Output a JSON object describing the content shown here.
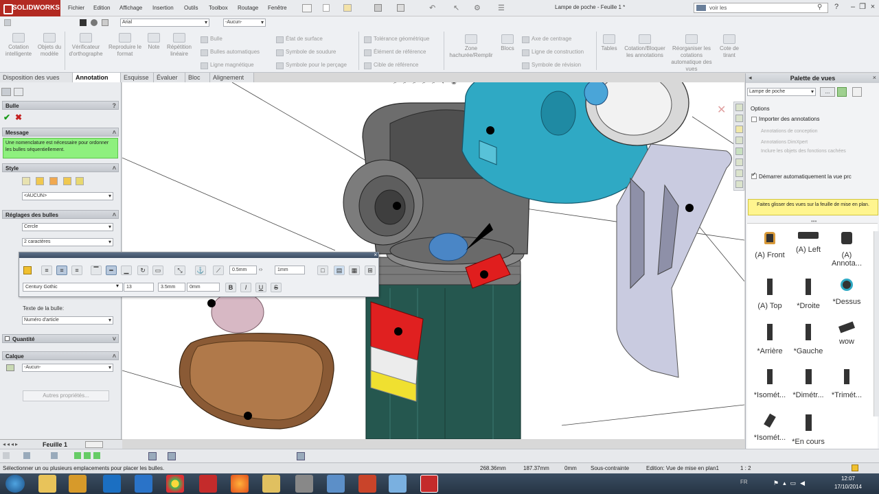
{
  "app": {
    "logo": "SOLIDWORKS",
    "document_title": "Lampe de poche - Feuille 1 *",
    "search_placeholder": "voir les"
  },
  "menu": [
    "Fichier",
    "Edition",
    "Affichage",
    "Insertion",
    "Outils",
    "Toolbox",
    "Routage",
    "Fenêtre"
  ],
  "ribbon": {
    "font_combo": "Arial",
    "font_size_combo": "-Aucun-",
    "big_buttons": [
      "Cotation intelligente",
      "Objets du modèle",
      "Vérificateur d'orthographe",
      "Reproduire le format",
      "Note",
      "Répétition linéaire"
    ],
    "col1": [
      "Bulle",
      "Bulles automatiques",
      "Ligne magnétique"
    ],
    "col2": [
      "État de surface",
      "Symbole de soudure",
      "Symbole pour le perçage"
    ],
    "col3": [
      "Tolérance géométrique",
      "Élément de référence",
      "Cible de référence"
    ],
    "big2": [
      "Zone hachurée/Remplir",
      "Blocs"
    ],
    "col4": [
      "Axe de centrage",
      "Ligne de construction",
      "Symbole de révision"
    ],
    "big3": [
      "Tables",
      "Cotation/Bloquer les annotations",
      "Réorganiser les cotations automatique des vues",
      "Cote de tirant"
    ]
  },
  "tabs": [
    "Disposition des vues",
    "Annotation",
    "Esquisse",
    "Évaluer",
    "Bloc",
    "Alignement"
  ],
  "left_panel": {
    "title": "Bulle",
    "message_header": "Message",
    "message_text": "Une nomenclature est nécessaire pour ordonner les bulles séquentiellement.",
    "style_header": "Style",
    "style_combo": "<AUCUN>",
    "settings_header": "Réglages des bulles",
    "shape_combo": "Cercle",
    "size_combo": "2 caractères",
    "text_label": "Texte de la bulle:",
    "text_combo": "Numéro d'article",
    "quantity_header": "Quantité",
    "layer_header": "Calque",
    "layer_combo": "-Aucun-",
    "more_button": "Autres propriétés..."
  },
  "format_toolbar": {
    "font": "Century Gothic",
    "size": "13",
    "spacing1": "3.5mm",
    "spacing2": "0mm",
    "thickness": "0.5mm",
    "gap": "1mm",
    "bold": "B",
    "italic": "I",
    "underline": "U",
    "strike": "S"
  },
  "right_panel": {
    "title": "Palette de vues",
    "doc_combo": "Lampe de poche",
    "options_label": "Options",
    "import_annotations": "Importer des annotations",
    "design_annotations": "Annotations de conception",
    "dimxpert_annotations": "Annotations DimXpert",
    "hidden_items": "Inclure les objets des fonctions cachées",
    "auto_start": "Démarrer automatiquement la vue prc",
    "info": "Faites glisser des vues sur la feuille de mise en plan.",
    "views": [
      "(A) Front",
      "(A) Left",
      "(A) Annota...",
      "(A) Top",
      "*Droite",
      "*Dessus",
      "*Arrière",
      "*Gauche",
      "wow",
      "*Isomét...",
      "*Dimétr...",
      "*Trimét...",
      "*Isomét...",
      "*En cours"
    ]
  },
  "sheet_tab": "Feuille 1",
  "status_bar": {
    "message": "Sélectionner un ou plusieurs emplacements pour placer les bulles.",
    "x": "268.36mm",
    "y": "187.37mm",
    "z": "0mm",
    "state": "Sous-contrainte",
    "mode": "Edition: Vue de mise en plan1",
    "scale": "1 : 2"
  },
  "taskbar": {
    "time": "12:07",
    "date": "17/10/2014",
    "lang": "FR"
  },
  "colors": {
    "accent": "#b22a22",
    "message_bg": "#8ef07e",
    "info_bg": "#fff58f",
    "taskbar": "#2c3b4d"
  }
}
